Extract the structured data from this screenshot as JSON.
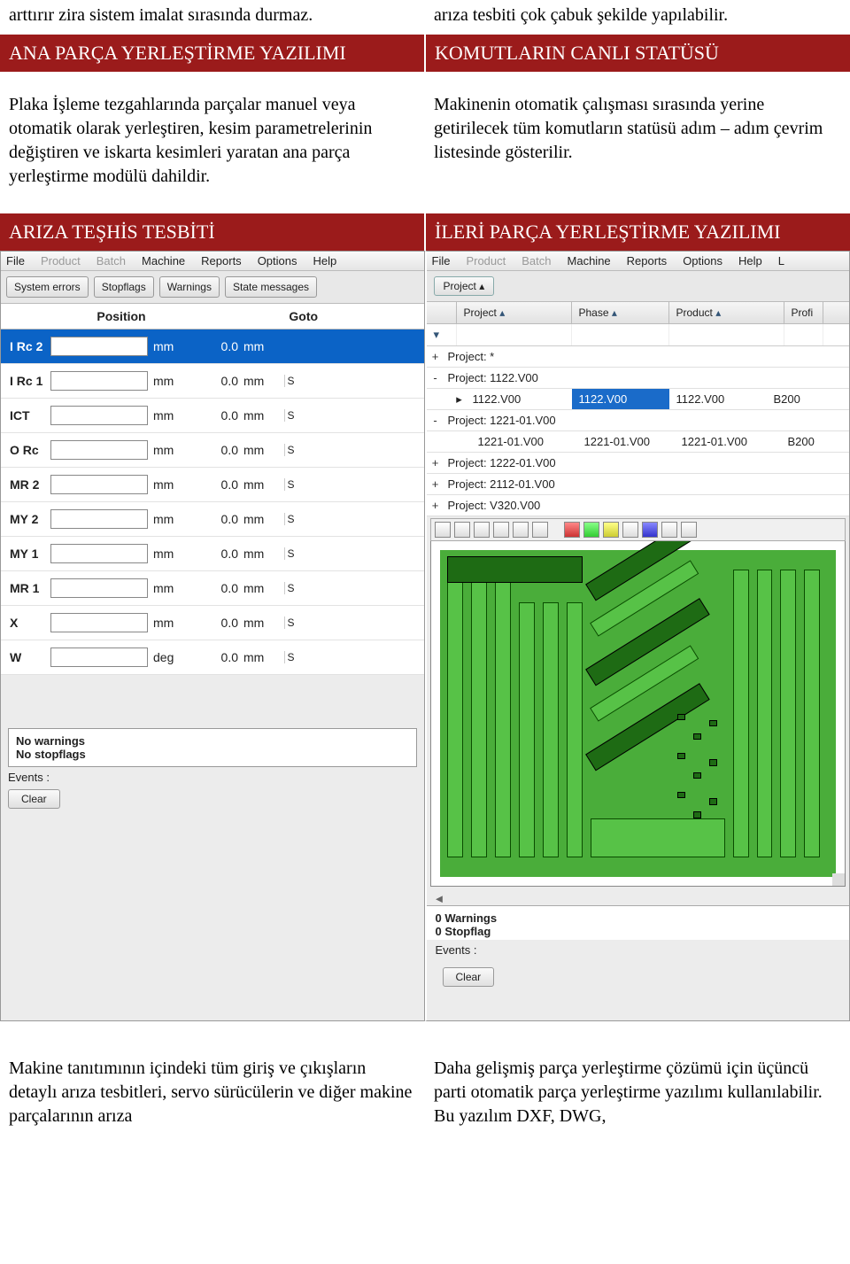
{
  "top_paragraphs": {
    "left": "arttırır zira sistem imalat sırasında durmaz.",
    "right": "arıza tesbiti çok çabuk şekilde yapılabilir."
  },
  "red_band_1": {
    "left": "ANA PARÇA YERLEŞTİRME YAZILIMI",
    "right": "KOMUTLARIN CANLI STATÜSÜ"
  },
  "body_paragraphs": {
    "left": "Plaka İşleme tezgahlarında parçalar manuel veya otomatik olarak yerleştiren, kesim parametrelerinin değiştiren ve iskarta kesimleri yaratan ana parça yerleştirme modülü dahildir.",
    "right": "Makinenin otomatik çalışması sırasında yerine getirilecek tüm komutların statüsü adım – adım çevrim listesinde gösterilir."
  },
  "red_band_2": {
    "left": "ARIZA TEŞHİS TESBİTİ",
    "right": "İLERİ PARÇA YERLEŞTİRME YAZILIMI"
  },
  "left_shot": {
    "menu": [
      "File",
      "Product",
      "Batch",
      "Machine",
      "Reports",
      "Options",
      "Help"
    ],
    "menu_dim": [
      "Product",
      "Batch"
    ],
    "tabs": [
      "System errors",
      "Stopflags",
      "Warnings",
      "State messages"
    ],
    "headers": {
      "position": "Position",
      "goto": "Goto"
    },
    "rows": [
      {
        "label": "I Rc 2",
        "unit": "mm",
        "goto": "0.0",
        "gunit": "mm",
        "selected": true
      },
      {
        "label": "I Rc 1",
        "unit": "mm",
        "goto": "0.0",
        "gunit": "mm",
        "tail": "S"
      },
      {
        "label": "ICT",
        "unit": "mm",
        "goto": "0.0",
        "gunit": "mm",
        "tail": "S"
      },
      {
        "label": "O Rc",
        "unit": "mm",
        "goto": "0.0",
        "gunit": "mm",
        "tail": "S"
      },
      {
        "label": "MR 2",
        "unit": "mm",
        "goto": "0.0",
        "gunit": "mm",
        "tail": "S"
      },
      {
        "label": "MY 2",
        "unit": "mm",
        "goto": "0.0",
        "gunit": "mm",
        "tail": "S"
      },
      {
        "label": "MY 1",
        "unit": "mm",
        "goto": "0.0",
        "gunit": "mm",
        "tail": "S"
      },
      {
        "label": "MR 1",
        "unit": "mm",
        "goto": "0.0",
        "gunit": "mm",
        "tail": "S"
      },
      {
        "label": "X",
        "unit": "mm",
        "goto": "0.0",
        "gunit": "mm",
        "tail": "S"
      },
      {
        "label": "W",
        "unit": "deg",
        "goto": "0.0",
        "gunit": "mm",
        "tail": "S"
      }
    ],
    "status": {
      "line1": "No warnings",
      "line2": "No stopflags"
    },
    "events_label": "Events :",
    "clear": "Clear"
  },
  "right_shot": {
    "menu": [
      "File",
      "Product",
      "Batch",
      "Machine",
      "Reports",
      "Options",
      "Help",
      "L"
    ],
    "menu_dim": [
      "Product",
      "Batch"
    ],
    "sort_chip": "Project",
    "grid_headers": {
      "c1": "",
      "c2": "Project",
      "c3": "Phase",
      "c4": "Product",
      "c5": "Profi"
    },
    "rows": [
      {
        "type": "group",
        "toggle": "+",
        "label": "Project: *"
      },
      {
        "type": "group",
        "toggle": "-",
        "label": "Project: 1122.V00"
      },
      {
        "type": "sub",
        "arrow": true,
        "c1": "1122.V00",
        "c1_sel": true,
        "c2": "1122.V00",
        "c3": "1122.V00",
        "c4": "B200"
      },
      {
        "type": "group",
        "toggle": "-",
        "label": "Project: 1221-01.V00"
      },
      {
        "type": "sub2",
        "c1": "1221-01.V00",
        "c2": "1221-01.V00",
        "c3": "1221-01.V00",
        "c4": "B200"
      },
      {
        "type": "group",
        "toggle": "+",
        "label": "Project: 1222-01.V00"
      },
      {
        "type": "group",
        "toggle": "+",
        "label": "Project: 2112-01.V00"
      },
      {
        "type": "group",
        "toggle": "+",
        "label": "Project: V320.V00"
      }
    ],
    "warnings": {
      "line1": "0 Warnings",
      "line2": "0 Stopflag"
    },
    "events_label": "Events :",
    "clear": "Clear"
  },
  "bottom_paragraphs": {
    "left": "Makine tanıtımının içindeki tüm giriş ve çıkışların detaylı arıza tesbitleri, servo sürücülerin ve diğer makine parçalarının arıza",
    "right": "Daha gelişmiş parça yerleştirme çözümü için üçüncü parti otomatik parça yerleştirme yazılımı kullanılabilir. Bu yazılım DXF, DWG,"
  }
}
